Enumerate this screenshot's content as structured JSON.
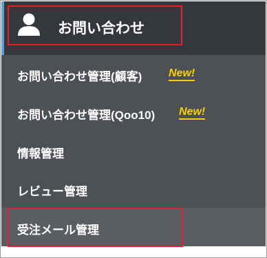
{
  "header": {
    "title": "お問い合わせ",
    "icon": "user-icon"
  },
  "menu": {
    "items": [
      {
        "label": "お問い合わせ管理(顧客)",
        "badge": "New!"
      },
      {
        "label": "お問い合わせ管理(Qoo10)",
        "badge": "New!"
      },
      {
        "label": "情報管理"
      },
      {
        "label": "レビュー管理"
      },
      {
        "label": "受注メール管理"
      }
    ]
  },
  "colors": {
    "menu_bg": "#4d5054",
    "header_bg": "#34373b",
    "accent": "#5d9fd6",
    "badge": "#f7d100",
    "highlight_border": "#e0202a"
  }
}
